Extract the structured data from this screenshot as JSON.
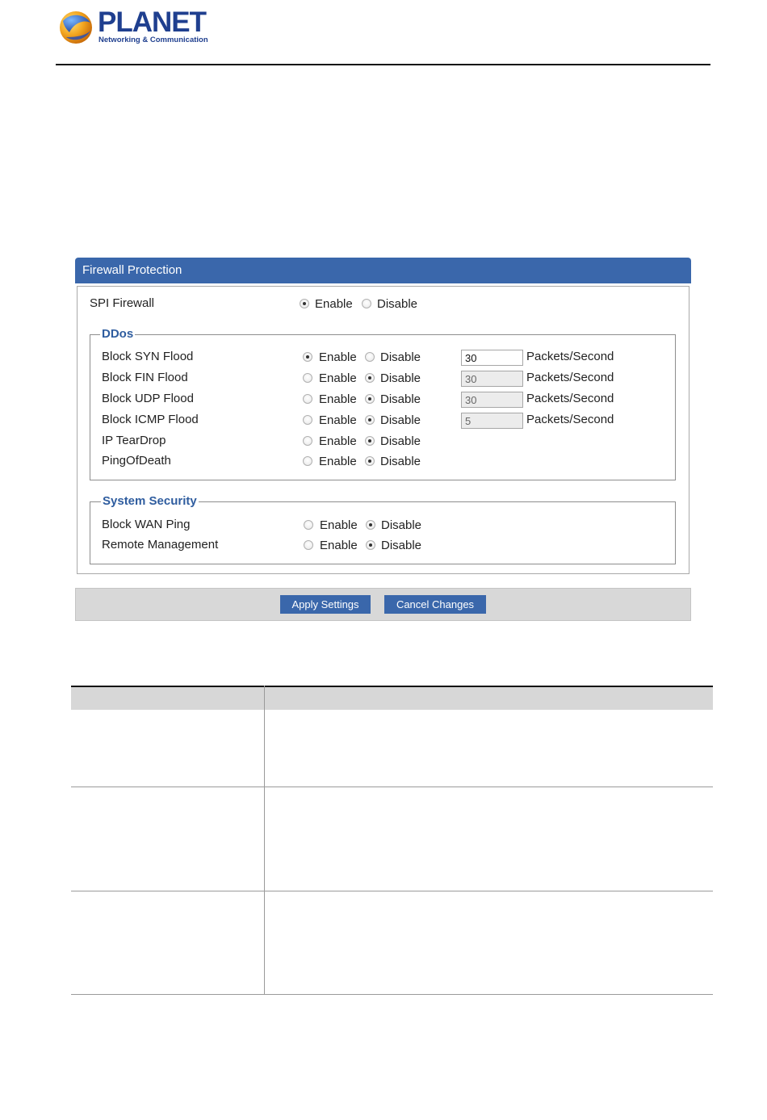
{
  "header": {
    "brand": "PLANET",
    "tagline": "Networking & Communication"
  },
  "panel": {
    "title": "Firewall Protection",
    "enable_label": "Enable",
    "disable_label": "Disable",
    "unit_label": "Packets/Second",
    "spi": {
      "label": "SPI Firewall",
      "value": "Enable"
    },
    "ddos": {
      "legend": "DDos",
      "rows": [
        {
          "label": "Block SYN Flood",
          "value": "Enable",
          "rate": "30",
          "rate_disabled": false
        },
        {
          "label": "Block FIN Flood",
          "value": "Disable",
          "rate": "30",
          "rate_disabled": true
        },
        {
          "label": "Block UDP Flood",
          "value": "Disable",
          "rate": "30",
          "rate_disabled": true
        },
        {
          "label": "Block ICMP Flood",
          "value": "Disable",
          "rate": "5",
          "rate_disabled": true
        },
        {
          "label": "IP TearDrop",
          "value": "Disable"
        },
        {
          "label": "PingOfDeath",
          "value": "Disable"
        }
      ]
    },
    "system_security": {
      "legend": "System Security",
      "rows": [
        {
          "label": "Block WAN Ping",
          "value": "Disable"
        },
        {
          "label": "Remote Management",
          "value": "Disable"
        }
      ]
    }
  },
  "buttons": {
    "apply": "Apply Settings",
    "cancel": "Cancel Changes"
  },
  "colors": {
    "accent": "#3a67ab",
    "legend": "#2f5d9f",
    "brand": "#1f3f8f"
  }
}
